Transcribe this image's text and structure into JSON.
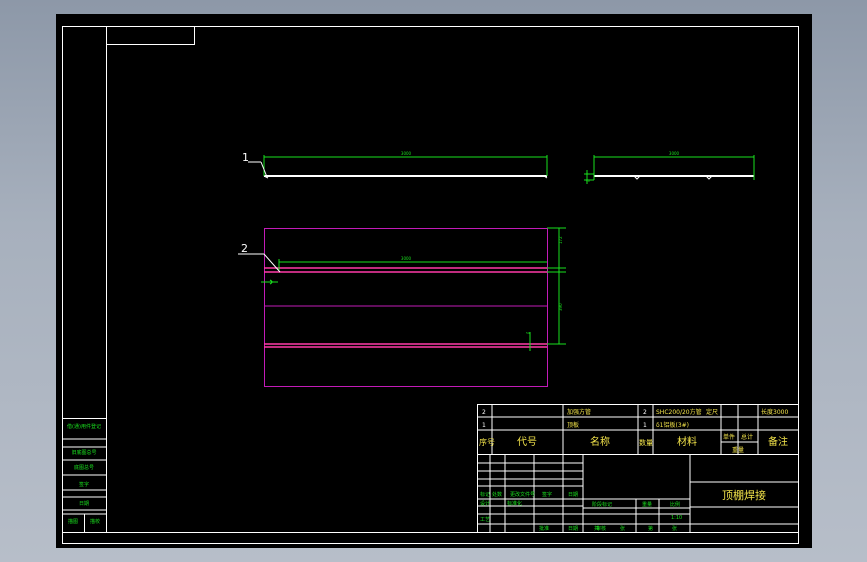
{
  "colors": {
    "background": "#000000",
    "frame": "#ffffff",
    "dimension": "#19e11e",
    "part_outline": "#c21bb8",
    "part_line": "#ff3aa8",
    "leader_text": "#ffffff"
  },
  "balloons": {
    "item1": "1",
    "item2": "2"
  },
  "dimensions": {
    "top_length": "3000",
    "side_length": "3000",
    "plan_length": "3000",
    "plan_width_upper": "172",
    "plan_width_lower": "390",
    "small_mark_a": "50",
    "small_mark_b": "50"
  },
  "bom": {
    "rows": [
      {
        "no": "2",
        "code": "",
        "name": "加强方管",
        "qty": "2",
        "material": "SHC200/20方管",
        "remark_label": "定尺",
        "remark": "长度3000"
      },
      {
        "no": "1",
        "code": "",
        "name": "顶板",
        "qty": "1",
        "material": "δ1铝板(3#)",
        "remark_label": "",
        "remark": ""
      }
    ],
    "headers": {
      "no": "序号",
      "code": "代号",
      "name": "名称",
      "qty": "数量",
      "material": "材料",
      "unit": "单件",
      "total": "总计",
      "weight": "重量",
      "remark": "备注"
    }
  },
  "title_block": {
    "drawing_title": "顶棚焊接",
    "sign_labels": [
      "标记",
      "处数",
      "更改文件号",
      "签字",
      "日期"
    ],
    "role_labels": [
      "设计",
      "审核",
      "工艺",
      "批准"
    ],
    "stage_labels": [
      "阶段标记",
      "重量",
      "比例"
    ],
    "scale": "1:10",
    "sheet_labels": [
      "共",
      "张",
      "第",
      "张"
    ],
    "date_label": "日期",
    "standardize_label": "标准化"
  },
  "side_strip": {
    "labels": [
      "借(通)用件登记",
      "旧底图总号",
      "底图总号",
      "签字",
      "日期",
      "描图",
      "描校"
    ]
  }
}
